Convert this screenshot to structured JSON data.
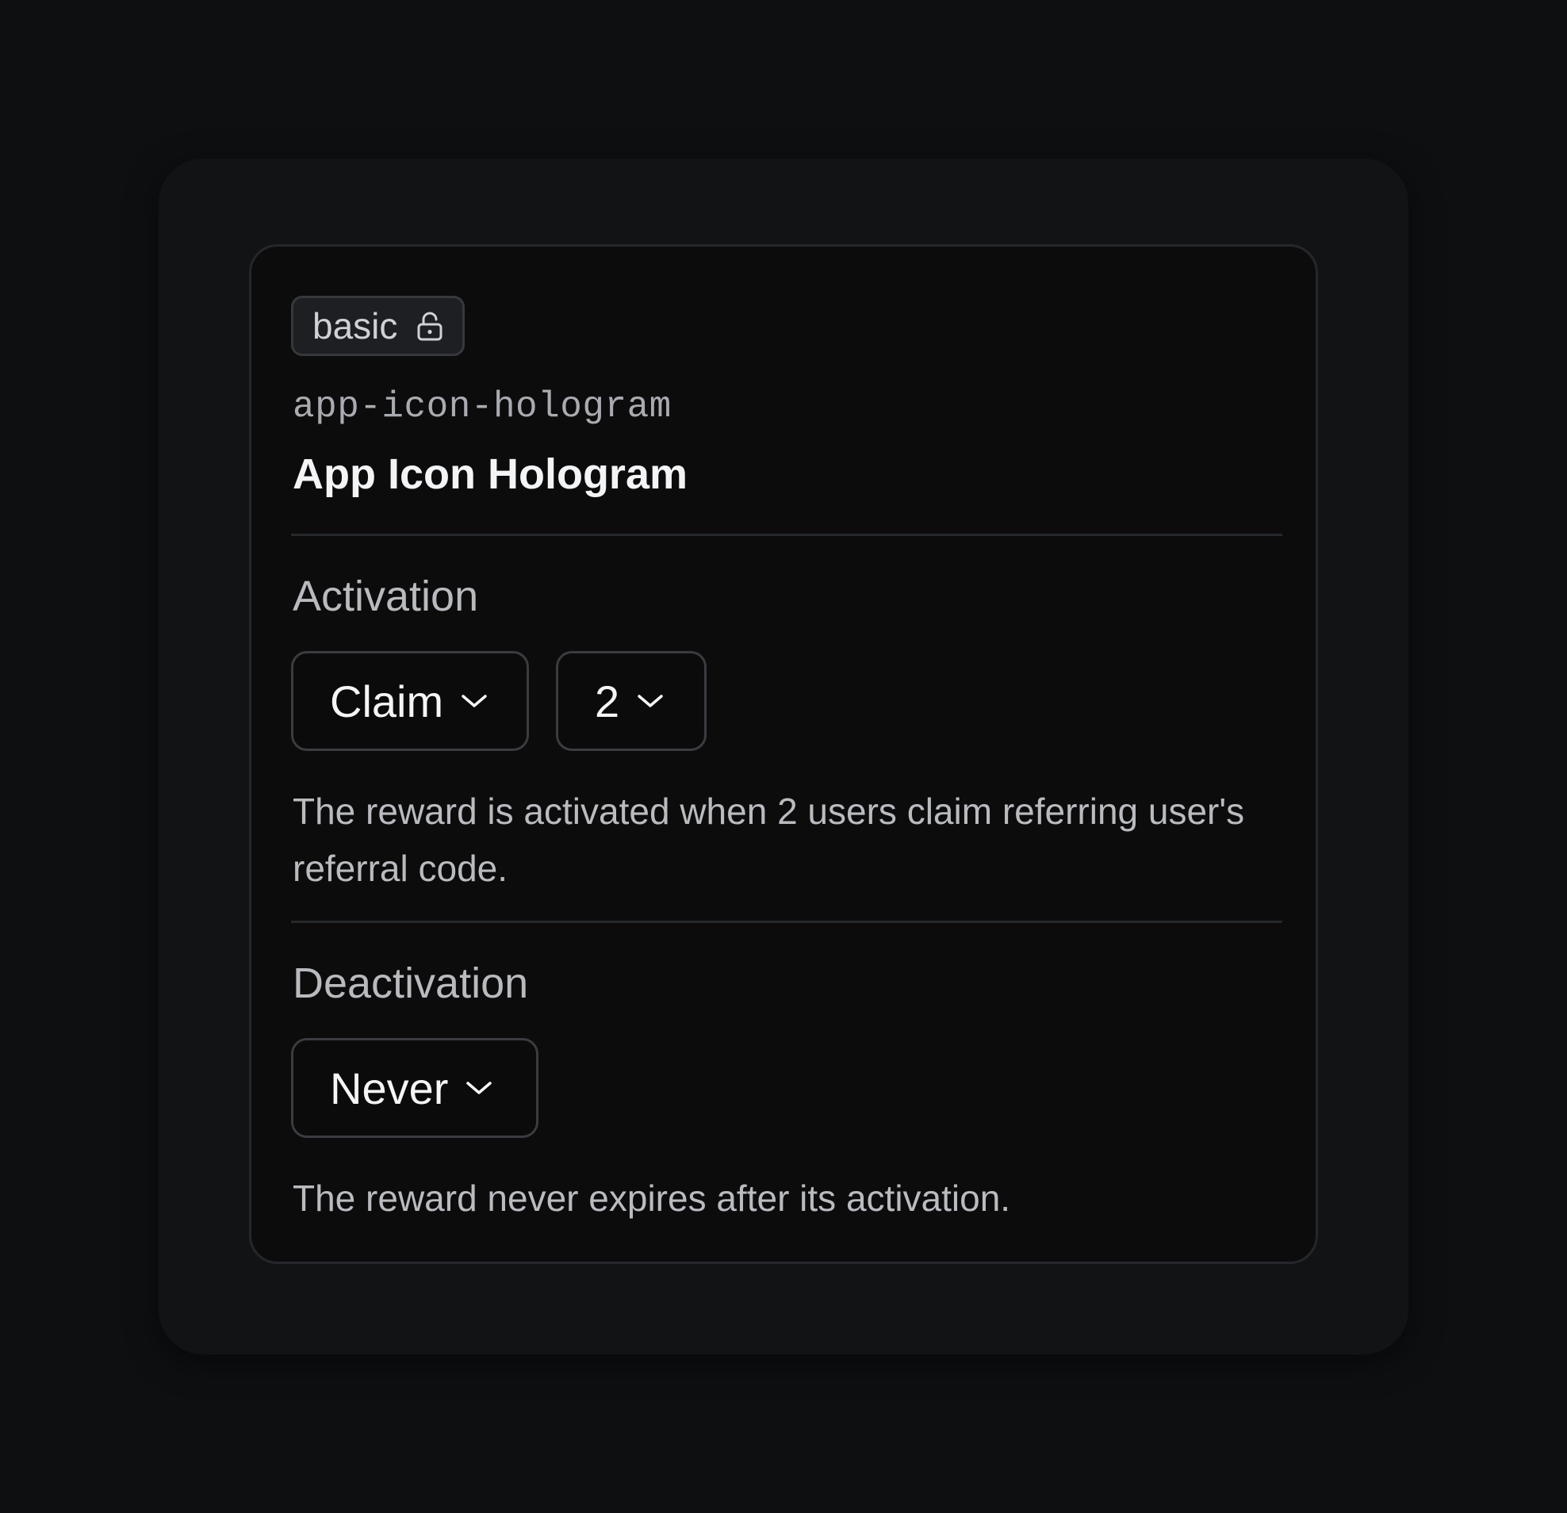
{
  "badge": {
    "label": "basic",
    "icon": "lock-open-icon"
  },
  "item": {
    "slug": "app-icon-hologram",
    "title": "App Icon Hologram"
  },
  "activation": {
    "label": "Activation",
    "type_select": {
      "value": "Claim"
    },
    "count_select": {
      "value": "2"
    },
    "description": "The reward is activated when 2 users claim referring user's referral code."
  },
  "deactivation": {
    "label": "Deactivation",
    "select": {
      "value": "Never"
    },
    "description": "The reward never expires after its activation."
  },
  "colors": {
    "background": "#0e0f11",
    "panel": "#121315",
    "card": "#0c0c0d",
    "border": "#26272b",
    "text_primary": "#f3f4f6",
    "text_secondary": "#b9bbbf"
  }
}
